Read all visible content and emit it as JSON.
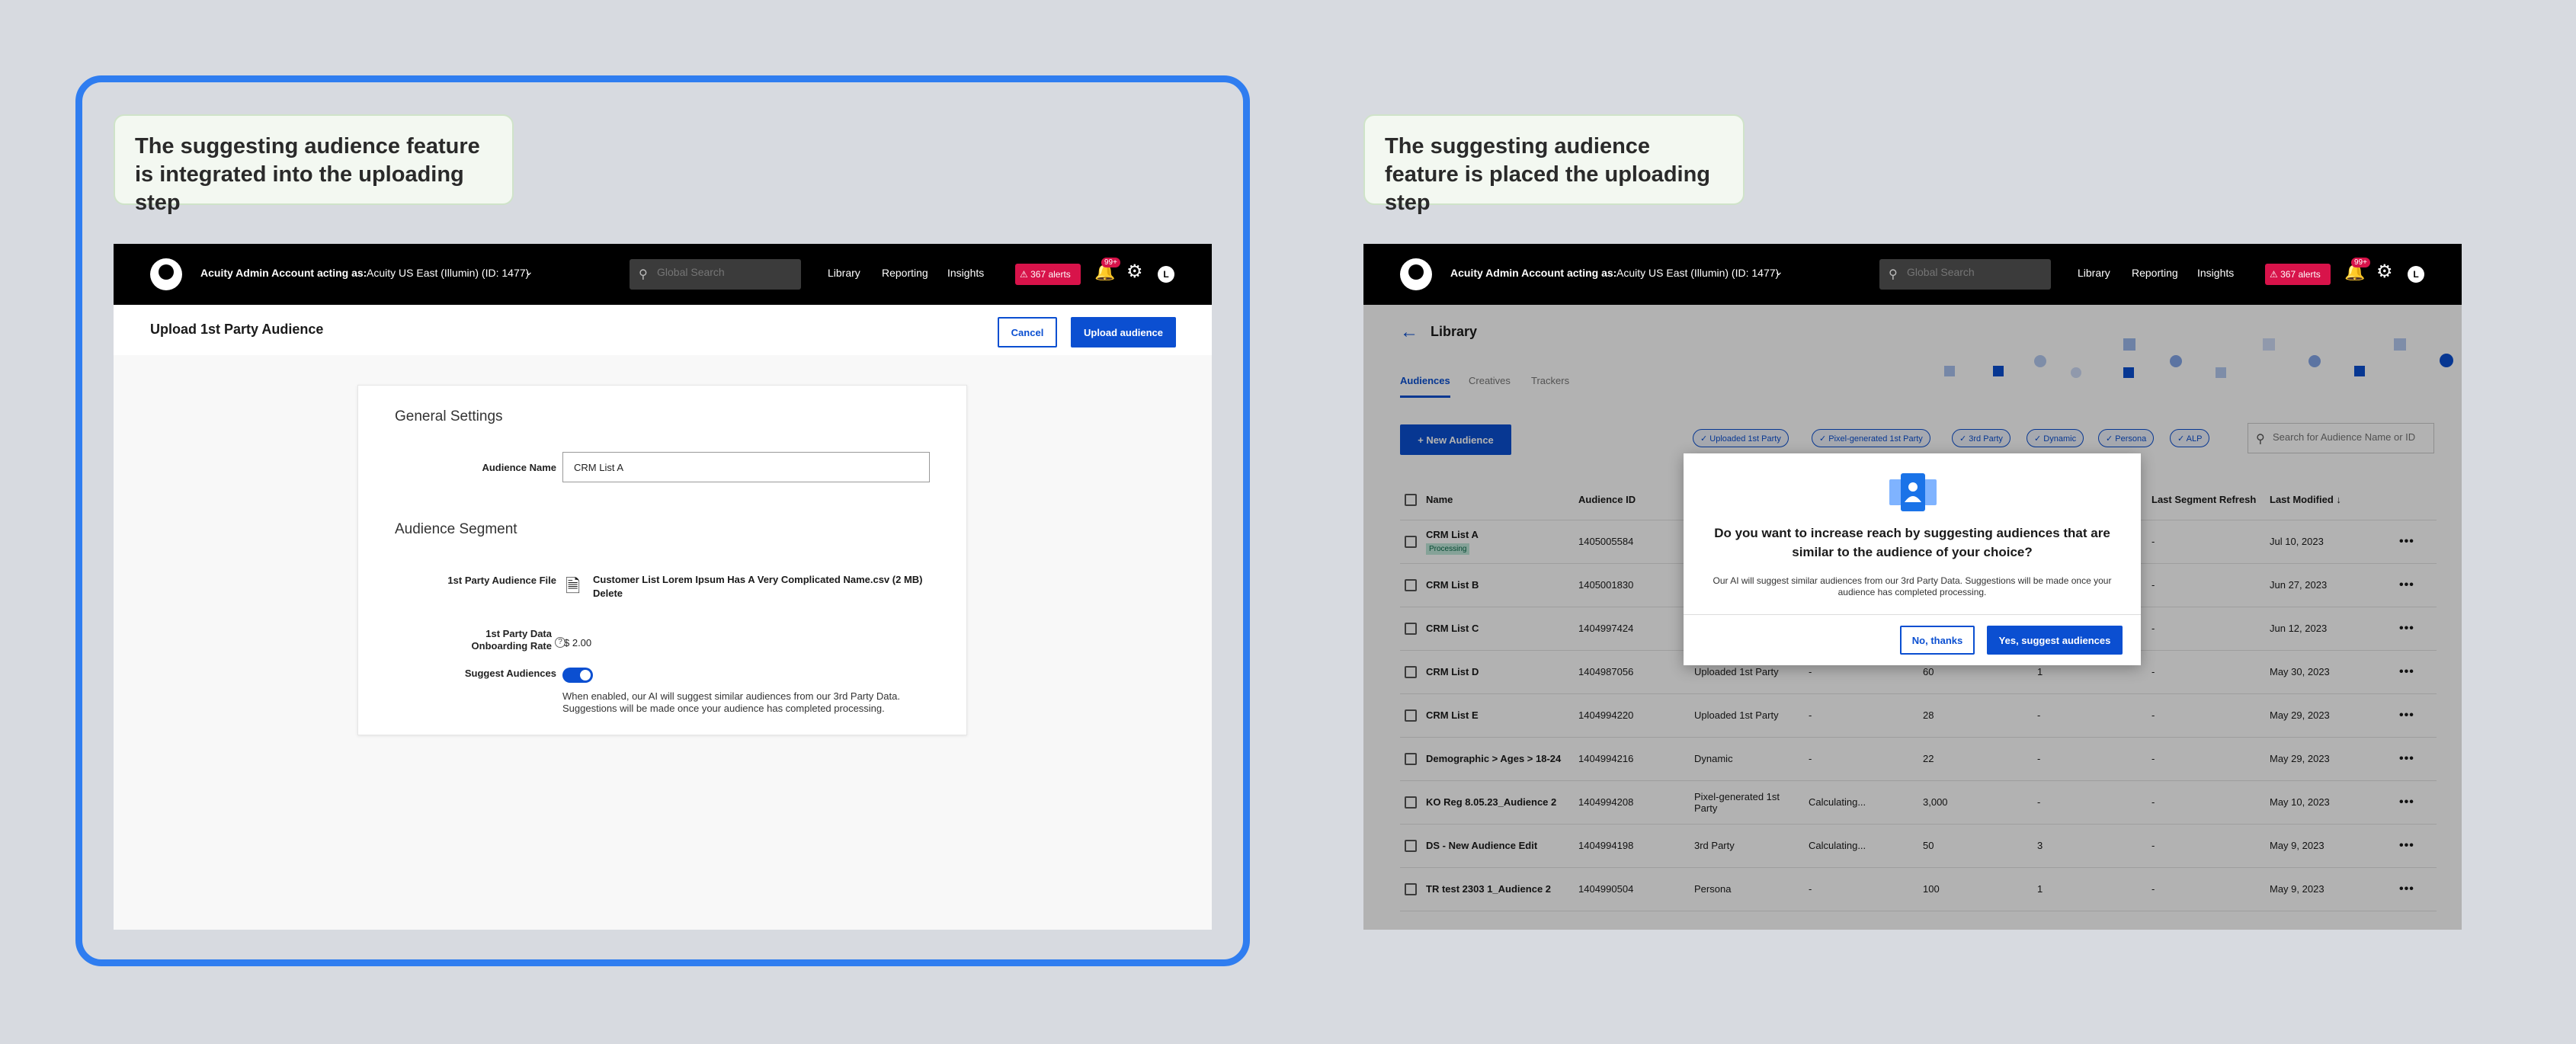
{
  "callouts": {
    "left": "The suggesting audience feature is integrated into the uploading step",
    "right": "The suggesting audience feature is placed the uploading step"
  },
  "topbar": {
    "account_label": "Acuity Admin Account acting as:",
    "account_value": "Acuity US East (Illumin) (ID: 1477)",
    "search_placeholder": "Global Search",
    "nav": [
      "Library",
      "Reporting",
      "Insights"
    ],
    "alerts": "367 alerts",
    "notif_badge": "99+",
    "user_initial": "L"
  },
  "upload": {
    "title": "Upload 1st Party Audience",
    "cancel": "Cancel",
    "upload_button": "Upload audience",
    "general_settings": "General Settings",
    "audience_name_label": "Audience Name",
    "audience_name_value": "CRM List A",
    "audience_segment": "Audience Segment",
    "file_label": "1st Party Audience File",
    "file_name": "Customer List Lorem Ipsum Has A Very Complicated Name.csv (2 MB)",
    "file_delete": "Delete",
    "rate_label_1": "1st Party Data",
    "rate_label_2": "Onboarding Rate",
    "rate_value": "$ 2.00",
    "help_glyph": "?",
    "suggest_label": "Suggest Audiences",
    "suggest_desc": "When enabled, our AI will suggest similar audiences from our 3rd Party Data. Suggestions will be made once your audience has completed processing."
  },
  "library": {
    "title": "Library",
    "tabs": [
      "Audiences",
      "Creatives",
      "Trackers"
    ],
    "new_audience": "+ New Audience",
    "chips": [
      "Uploaded 1st Party",
      "Pixel-generated 1st Party",
      "3rd Party",
      "Dynamic",
      "Persona",
      "ALP"
    ],
    "search_placeholder": "Search for Audience Name or ID",
    "columns": [
      "Name",
      "Audience ID",
      "",
      "",
      "",
      "",
      "Last Segment Refresh",
      "Last Modified ↓"
    ],
    "rows": [
      {
        "name": "CRM List A",
        "tag": "Processing",
        "id": "1405005584",
        "type": "",
        "c4": "",
        "size": "",
        "c6": "",
        "refresh": "-",
        "modified": "Jul 10, 2023"
      },
      {
        "name": "CRM List B",
        "tag": "",
        "id": "1405001830",
        "type": "",
        "c4": "",
        "size": "",
        "c6": "",
        "refresh": "-",
        "modified": "Jun 27, 2023"
      },
      {
        "name": "CRM List C",
        "tag": "",
        "id": "1404997424",
        "type": "",
        "c4": "",
        "size": "",
        "c6": "",
        "refresh": "-",
        "modified": "Jun 12, 2023"
      },
      {
        "name": "CRM List D",
        "tag": "",
        "id": "1404987056",
        "type": "Uploaded 1st Party",
        "c4": "-",
        "size": "60",
        "c6": "1",
        "refresh": "-",
        "modified": "May 30, 2023"
      },
      {
        "name": "CRM List E",
        "tag": "",
        "id": "1404994220",
        "type": "Uploaded 1st Party",
        "c4": "-",
        "size": "28",
        "c6": "-",
        "refresh": "-",
        "modified": "May 29, 2023"
      },
      {
        "name": "Demographic > Ages > 18-24",
        "tag": "",
        "id": "1404994216",
        "type": "Dynamic",
        "c4": "-",
        "size": "22",
        "c6": "-",
        "refresh": "-",
        "modified": "May 29, 2023"
      },
      {
        "name": "KO Reg 8.05.23_Audience 2",
        "tag": "",
        "id": "1404994208",
        "type": "Pixel-generated 1st Party",
        "c4": "Calculating...",
        "size": "3,000",
        "c6": "-",
        "refresh": "-",
        "modified": "May 10, 2023"
      },
      {
        "name": "DS - New Audience Edit",
        "tag": "",
        "id": "1404994198",
        "type": "3rd Party",
        "c4": "Calculating...",
        "size": "50",
        "c6": "3",
        "refresh": "-",
        "modified": "May 9, 2023"
      },
      {
        "name": "TR test 2303 1_Audience 2",
        "tag": "",
        "id": "1404990504",
        "type": "Persona",
        "c4": "-",
        "size": "100",
        "c6": "1",
        "refresh": "-",
        "modified": "May 9, 2023"
      }
    ],
    "row_menu": "•••"
  },
  "modal": {
    "title": "Do you want to increase reach by suggesting audiences that are similar to the audience of your choice?",
    "text": "Our AI will suggest similar audiences from our 3rd Party Data. Suggestions will be made once your audience has completed processing.",
    "decline": "No, thanks",
    "accept": "Yes, suggest audiences"
  },
  "colors": {
    "accent": "#0b4fd1",
    "alert": "#d8134a",
    "frame": "#2f7df0"
  }
}
